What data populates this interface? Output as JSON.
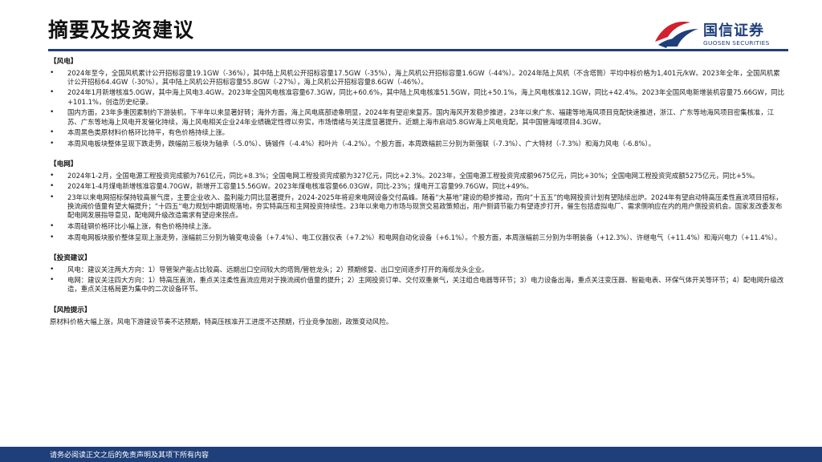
{
  "header": {
    "title": "摘要及投资建议",
    "logo_cn": "国信证券",
    "logo_en": "GUOSEN SECURITIES"
  },
  "sections": [
    {
      "heading": "【风电】",
      "bullets": [
        "2024年至今，全国风机累计公开招标容量19.1GW（-36%），其中陆上风机公开招标容量17.5GW（-35%），海上风机公开招标容量1.6GW（-44%）。2024年陆上风机（不含塔筒）平均中标价格为1,401元/kW。2023年全年，全国风机累计公开招标64.4GW（-30%），其中陆上风机公开招标容量55.8GW（-27%），海上风机公开招标容量8.6GW（-46%）。",
        "2024年1月新增核准5.0GW，其中海上风电3.4GW。2023年全国风电核准容量67.3GW，同比+60.6%，其中陆上风电核准51.5GW，同比+50.1%，海上风电核准12.1GW，同比+42.4%。2023年全国风电新增装机容量75.66GW，同比+101.1%，创造历史纪录。",
        "国内方面，23年多重因素制约下游装机，下半年以来显著好转；海外方面，海上风电底部迹象明显，2024年有望迎来复苏。国内海风开发稳步推进，23年以来广东、福建等地海风项目竞配快速推进，浙江、广东等地海风项目密集核准，江苏、广东等地海上风电开发催化持续，海上风电相关企业24年业绩确定性得以夯实，市场情绪与关注度显著提升。近期上海市启动5.8GW海上风电竞配，其中国管海域项目4.3GW。",
        "本周黑色类原材料价格环比持平，有色价格持续上涨。",
        "本周风电板块整体呈现下跌走势，跌幅前三板块为轴承（-5.0%）、铸锻件（-4.4%）和叶片（-4.2%）。个股方面，本周跌幅前三分别为新强联（-7.3%）、广大特材（-7.3%）和海力风电（-6.8%）。"
      ]
    },
    {
      "heading": "【电网】",
      "bullets": [
        "2024年1-2月，全国电源工程投资完成额为761亿元，同比+8.3%；全国电网工程投资完成额为327亿元，同比+2.3%。2023年，全国电源工程投资完成额9675亿元，同比+30%；全国电网工程投资完成额5275亿元，同比+5%。",
        "2024年1-4月煤电新增核准容量4.70GW，新增开工容量15.56GW。2023年煤电核准容量66.03GW，同比-23%；煤电开工容量99.76GW，同比+49%。",
        "23年以来电网招标保持较高景气度，主要企业收入、盈利能力同比显著提升，2024-2025年将迎来电网设备交付高峰。随着“大基地”建设的稳步推动，而向“十五五”的电网投资计划有望陆续出炉。2024年有望启动特高压柔性直流项目招标，换流阀价值量有望大幅提升；“十四五“电力规划中期调规落地，夯实特高压和主网投资持续性。23年以来电力市场与现货交易政策频出，用户侧调节能力有望逐步打开，催生包括虚拟电厂、需求侧响应在内的用户侧投资机会。国家发改委发布配电网发展指导意见，配电网升级改造需求有望迎来拐点。",
        "本周硅钢价格环比小幅上涨，有色价格持续上涨。",
        "本周电网板块股价整体呈现上涨走势，涨幅前三分别为输变电设备（+7.4%）、电工仪器仪表（+7.2%）和电网自动化设备（+6.1%）。个股方面，本周涨幅前三分别为华明装备（+12.3%）、许继电气（+11.4%）和海兴电力（+11.4%）。"
      ]
    },
    {
      "heading": "【投资建议】",
      "bullets": [
        "风电：建议关注两大方向：1）导管架产能占比较高、远期出口空间较大的塔筒/管桩龙头；2）预期修复、出口空间逐步打开的海缆龙头企业。",
        "电网：建议关注四大方向：1）特高压直流，重点关注柔性直流应用对于换流阀价值量的提升；2）主网投资订单、交付双重景气，关注组合电器等环节；3）电力设备出海，重点关注变压器、智能电表、环保气体开关等环节；4）配电网升级改造，重点关注格局更为集中的二次设备环节。"
      ]
    },
    {
      "heading": "【风险提示】",
      "text": "原材料价格大幅上涨，风电下游建设节奏不达预期，特高压核准开工进度不达预期，行业竞争加剧，政策变动风险。"
    }
  ],
  "footer": {
    "text": "请务必阅读正文之后的免责声明及其项下所有内容"
  },
  "colors": {
    "brand_blue": "#1f3f7a",
    "brand_red": "#d2202f"
  }
}
